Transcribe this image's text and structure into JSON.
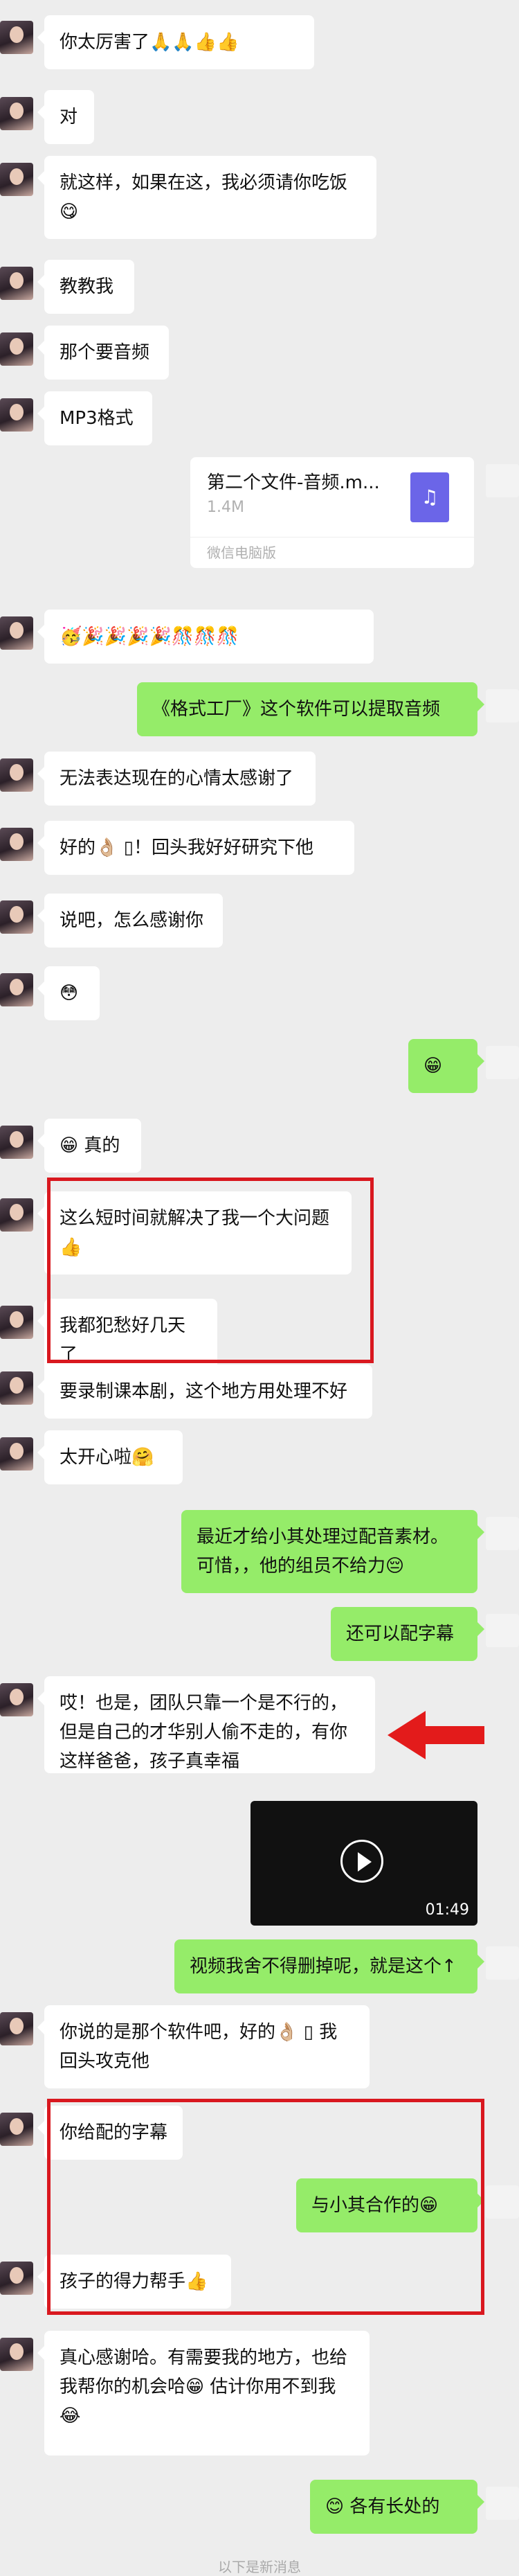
{
  "messages": [
    {
      "id": "m1",
      "side": "in",
      "text": "你太厉害了🙏🙏👍👍"
    },
    {
      "id": "m2",
      "side": "in",
      "text": "对"
    },
    {
      "id": "m3",
      "side": "in",
      "text": "就这样，如果在这，我必须请你吃饭😋"
    },
    {
      "id": "m4",
      "side": "in",
      "text": "教教我"
    },
    {
      "id": "m5",
      "side": "in",
      "text": "那个要音频"
    },
    {
      "id": "m6",
      "side": "in",
      "text": "MP3格式"
    },
    {
      "id": "m7",
      "side": "in",
      "text": "🥳🎉🎉🎉🎉🎊🎊🎊"
    },
    {
      "id": "m8",
      "side": "out",
      "text": "《格式工厂》这个软件可以提取音频"
    },
    {
      "id": "m9",
      "side": "in",
      "text": "无法表达现在的心情太感谢了"
    },
    {
      "id": "m10",
      "side": "in",
      "text": "好的👌🏼 ▯！回头我好好研究下他"
    },
    {
      "id": "m11",
      "side": "in",
      "text": "说吧，怎么感谢你"
    },
    {
      "id": "m12",
      "side": "in",
      "text": "😳"
    },
    {
      "id": "m13",
      "side": "out",
      "text": "😁"
    },
    {
      "id": "m14",
      "side": "in",
      "text": "😁 真的"
    },
    {
      "id": "m15",
      "side": "in",
      "text": "这么短时间就解决了我一个大问题👍"
    },
    {
      "id": "m16",
      "side": "in",
      "text": "我都犯愁好几天了"
    },
    {
      "id": "m17",
      "side": "in",
      "text": "要录制课本剧，这个地方用处理不好"
    },
    {
      "id": "m18",
      "side": "in",
      "text": "太开心啦🤗"
    },
    {
      "id": "m19",
      "side": "out",
      "text": "最近才给小其处理过配音素材。可惜，，他的组员不给力😔"
    },
    {
      "id": "m20",
      "side": "out",
      "text": "还可以配字幕"
    },
    {
      "id": "m21",
      "side": "in",
      "text": "哎！也是，团队只靠一个是不行的，但是自己的才华别人偷不走的，有你这样爸爸，孩子真幸福"
    },
    {
      "id": "m22",
      "side": "out",
      "text": "视频我舍不得删掉呢，就是这个↑"
    },
    {
      "id": "m23",
      "side": "in",
      "text": "你说的是那个软件吧，好的👌🏼 ▯ 我回头攻克他"
    },
    {
      "id": "m24",
      "side": "in",
      "text": "你给配的字幕"
    },
    {
      "id": "m25",
      "side": "out",
      "text": "与小其合作的😁"
    },
    {
      "id": "m26",
      "side": "in",
      "text": "孩子的得力帮手👍"
    },
    {
      "id": "m27",
      "side": "in",
      "text": "真心感谢哈。有需要我的地方，也给我帮你的机会哈😁 估计你用不到我😂"
    },
    {
      "id": "m28",
      "side": "out",
      "text": "😊 各有长处的"
    }
  ],
  "file": {
    "name": "第二个文件-音频.m...",
    "size": "1.4M",
    "source": "微信电脑版",
    "icon": "music-note-icon"
  },
  "video": {
    "duration": "01:49"
  },
  "bottom_note": "以下是新消息",
  "colors": {
    "out_bubble": "#95ec69",
    "in_bubble": "#ffffff",
    "background": "#ededed",
    "highlight": "#d9181f"
  }
}
